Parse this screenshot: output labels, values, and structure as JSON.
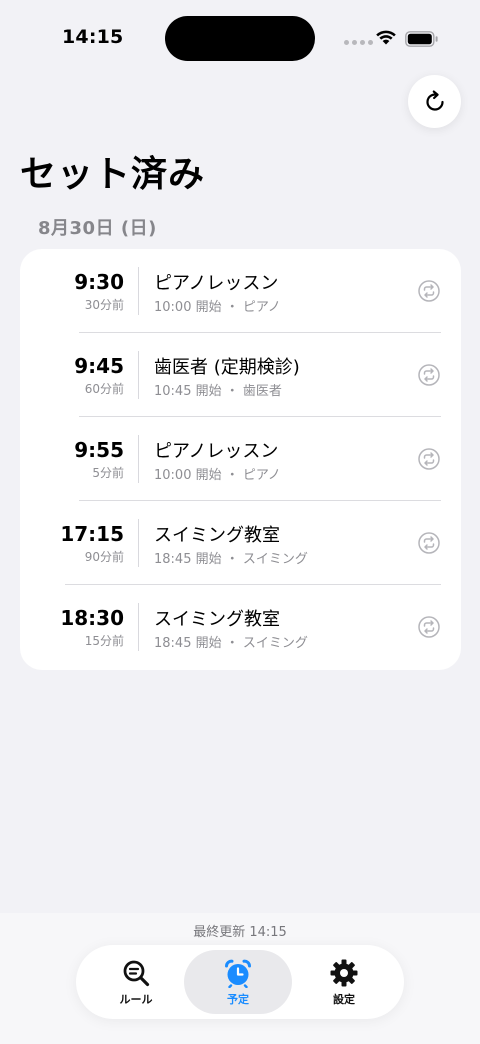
{
  "status_bar": {
    "time": "14:15"
  },
  "page": {
    "title": "セット済み",
    "date_header": "8月30日 (日)"
  },
  "alarms": [
    {
      "time": "9:30",
      "ago": "30分前",
      "title": "ピアノレッスン",
      "meta": "10:00 開始 ・ ピアノ"
    },
    {
      "time": "9:45",
      "ago": "60分前",
      "title": "歯医者 (定期検診)",
      "meta": "10:45 開始 ・ 歯医者"
    },
    {
      "time": "9:55",
      "ago": "5分前",
      "title": "ピアノレッスン",
      "meta": "10:00 開始 ・ ピアノ"
    },
    {
      "time": "17:15",
      "ago": "90分前",
      "title": "スイミング教室",
      "meta": "18:45 開始 ・ スイミング"
    },
    {
      "time": "18:30",
      "ago": "15分前",
      "title": "スイミング教室",
      "meta": "18:45 開始 ・ スイミング"
    }
  ],
  "footer": {
    "last_updated": "最終更新 14:15"
  },
  "tabs": [
    {
      "label": "ルール",
      "icon": "search-list-icon"
    },
    {
      "label": "予定",
      "icon": "alarm-clock-icon",
      "active": true
    },
    {
      "label": "設定",
      "icon": "gear-icon"
    }
  ],
  "colors": {
    "accent": "#1a8cff",
    "background": "#f2f2f6",
    "secondary_text": "#8e8e93"
  }
}
